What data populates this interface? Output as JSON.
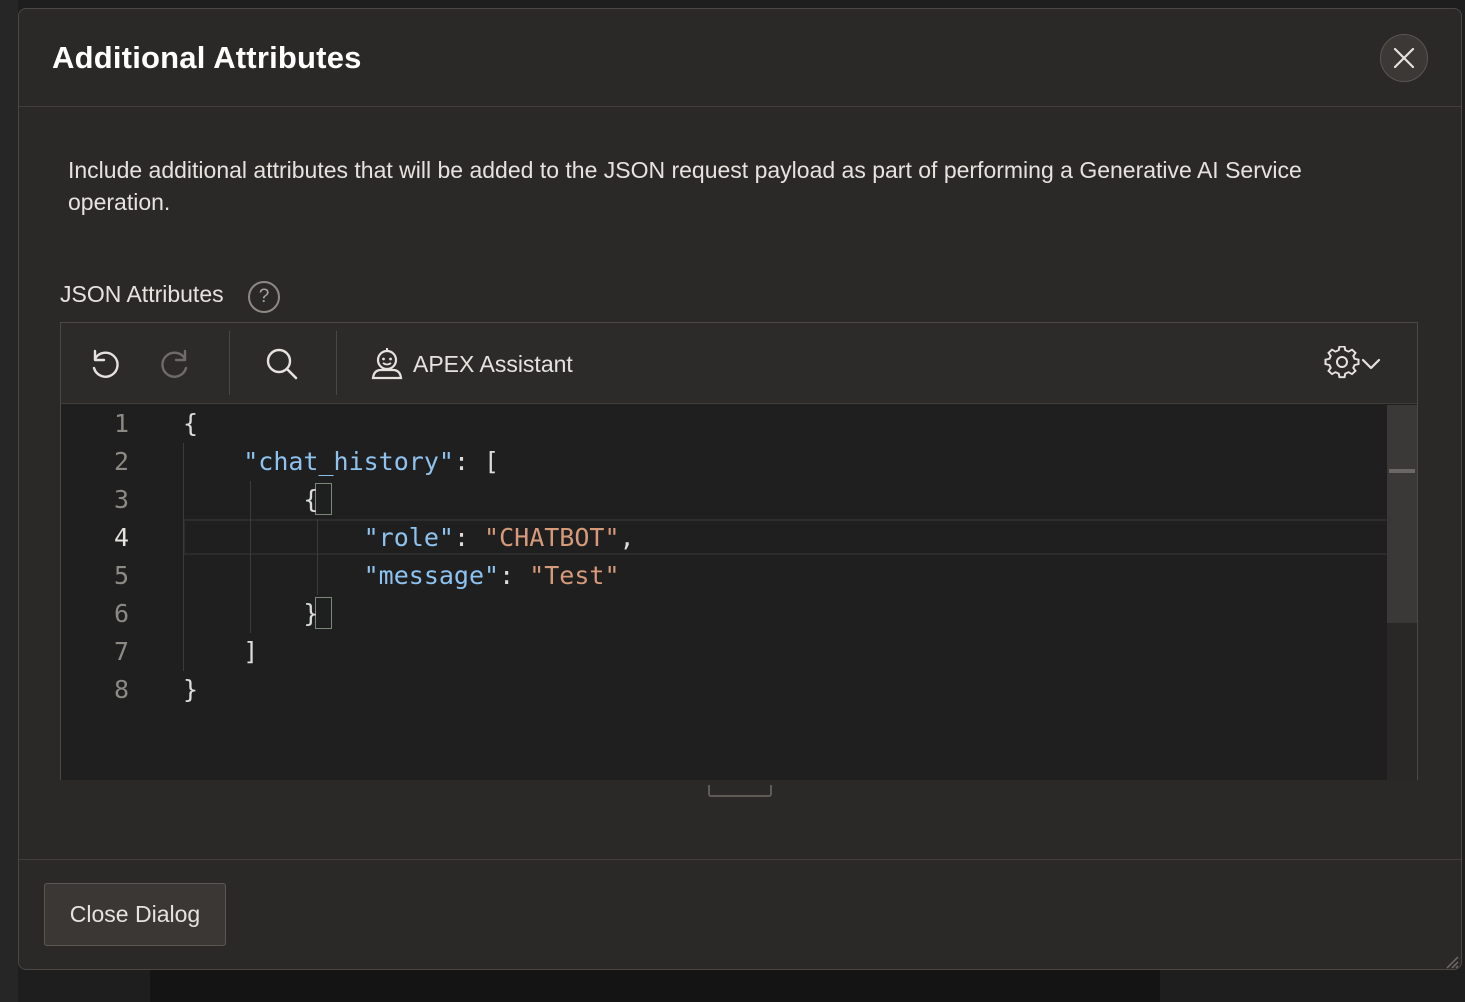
{
  "dialog": {
    "title": "Additional Attributes",
    "description": "Include additional attributes that will be added to the JSON request payload as part of performing a Generative AI Service operation.",
    "field_label": "JSON Attributes",
    "help_text": "?",
    "close_icon": "close-icon"
  },
  "toolbar": {
    "undo_icon": "undo-icon",
    "redo_icon": "redo-icon",
    "search_icon": "search-icon",
    "assistant_label": "APEX Assistant",
    "settings_icon": "gear-icon"
  },
  "editor": {
    "active_line": 4,
    "line_numbers": [
      "1",
      "2",
      "3",
      "4",
      "5",
      "6",
      "7",
      "8"
    ],
    "lines": [
      {
        "indent": "",
        "tokens": [
          {
            "t": "punc",
            "v": "{"
          }
        ]
      },
      {
        "indent": "    ",
        "tokens": [
          {
            "t": "key",
            "v": "\"chat_history\""
          },
          {
            "t": "punc",
            "v": ": ["
          }
        ]
      },
      {
        "indent": "        ",
        "tokens": [
          {
            "t": "punc",
            "v": "{"
          }
        ]
      },
      {
        "indent": "            ",
        "tokens": [
          {
            "t": "key",
            "v": "\"role\""
          },
          {
            "t": "punc",
            "v": ": "
          },
          {
            "t": "str",
            "v": "\"CHATBOT\""
          },
          {
            "t": "punc",
            "v": ","
          }
        ]
      },
      {
        "indent": "            ",
        "tokens": [
          {
            "t": "key",
            "v": "\"message\""
          },
          {
            "t": "punc",
            "v": ": "
          },
          {
            "t": "str",
            "v": "\"Test\""
          }
        ]
      },
      {
        "indent": "        ",
        "tokens": [
          {
            "t": "punc",
            "v": "}"
          }
        ]
      },
      {
        "indent": "    ",
        "tokens": [
          {
            "t": "punc",
            "v": "]"
          }
        ]
      },
      {
        "indent": "",
        "tokens": [
          {
            "t": "punc",
            "v": "}"
          }
        ]
      }
    ]
  },
  "footer": {
    "close_button_label": "Close Dialog"
  },
  "colors": {
    "dialog_bg": "#2b2927",
    "editor_bg": "#1f1f1f",
    "json_key": "#8ec3ef",
    "json_string": "#d69a7a"
  }
}
